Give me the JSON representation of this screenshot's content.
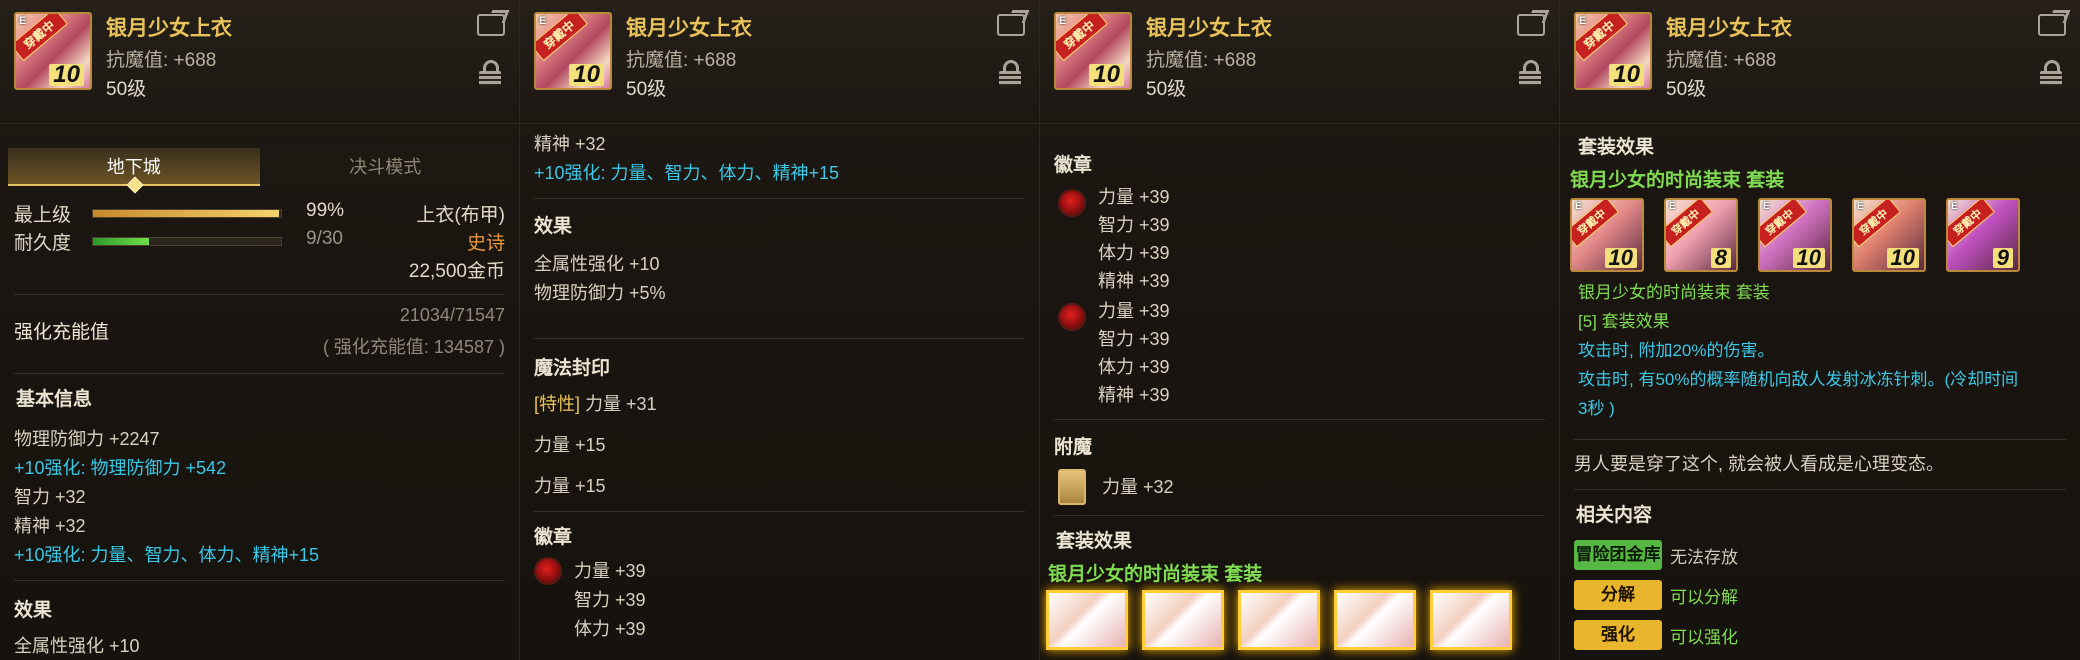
{
  "item": {
    "name": "银月少女上衣",
    "magic_resist": "抗魔值: +688",
    "level": "50级",
    "icon_stamp": "穿戴中",
    "icon_grade": "E",
    "icon_level": "10"
  },
  "panel1": {
    "tab_dungeon": "地下城",
    "tab_pvp": "决斗模式",
    "top_grade_label": "最上级",
    "top_grade_value": "99%",
    "top_grade_fill": 0.99,
    "durability_label": "耐久度",
    "durability_value": "9/30",
    "durability_fill": 0.3,
    "item_type": "上衣(布甲)",
    "rarity": "史诗",
    "price": "22,500金币",
    "enhance_charge_label": "强化充能值",
    "enhance_charge_value": "21034/71547",
    "enhance_charge_sub": "( 强化充能值: 134587 )",
    "basic_info_title": "基本信息",
    "basic_lines": [
      {
        "text": "物理防御力 +2247",
        "style": "normal"
      },
      {
        "text": "+10强化: 物理防御力 +542",
        "style": "blue"
      },
      {
        "text": "智力 +32",
        "style": "normal"
      },
      {
        "text": "精神 +32",
        "style": "normal"
      },
      {
        "text": "+10强化: 力量、智力、体力、精神+15",
        "style": "blue"
      }
    ],
    "effect_title": "效果",
    "effect_partial": "全属性强化 +10"
  },
  "panel2": {
    "line_spirit": "精神 +32",
    "line_enh": "+10强化: 力量、智力、体力、精神+15",
    "effect_title": "效果",
    "effect_lines": [
      "全属性强化 +10",
      "物理防御力 +5%"
    ],
    "seal_title": "魔法封印",
    "seal_trait_prefix": "[特性]",
    "seal_trait_text": " 力量 +31",
    "seal_lines": [
      "力量 +15",
      "力量 +15"
    ],
    "emblem_title": "徽章",
    "emblem_lines": [
      "力量 +39",
      "智力 +39",
      "体力 +39"
    ]
  },
  "panel3": {
    "emblem_title": "徽章",
    "emblem_group1": [
      "力量 +39",
      "智力 +39",
      "体力 +39",
      "精神 +39"
    ],
    "emblem_group2": [
      "力量 +39",
      "智力 +39",
      "体力 +39",
      "精神 +39"
    ],
    "enchant_title": "附魔",
    "enchant_value": "力量 +32",
    "set_title": "套装效果",
    "set_name": "银月少女的时尚装束 套装"
  },
  "panel4": {
    "set_title": "套装效果",
    "set_name": "银月少女的时尚装束 套装",
    "set_icons": [
      {
        "stamp": "穿戴中",
        "grade": "E",
        "level": "10",
        "color": "#e48a8a"
      },
      {
        "stamp": "穿戴中",
        "grade": "E",
        "level": "8",
        "color": "#f0a0b0"
      },
      {
        "stamp": "穿戴中",
        "grade": "E",
        "level": "10",
        "color": "#d070c0"
      },
      {
        "stamp": "穿戴中",
        "grade": "E",
        "level": "10",
        "color": "#e08070"
      },
      {
        "stamp": "穿戴中",
        "grade": "E",
        "level": "9",
        "color": "#c050c0"
      }
    ],
    "set_name2": "银月少女的时尚装束 套装",
    "set_bonus_title": "[5] 套装效果",
    "set_bonus_lines": [
      "攻击时, 附加20%的伤害。",
      "攻击时, 有50%的概率随机向敌人发射冰冻针刺。(冷却时间",
      "3秒 )"
    ],
    "flavor": "男人要是穿了这个, 就会被人看成是心理变态。",
    "related_title": "相关内容",
    "related": [
      {
        "tag": "冒险团金库",
        "text": "无法存放",
        "tag_style": "green-bg",
        "text_style": "normal"
      },
      {
        "tag": "分解",
        "text": "可以分解",
        "tag_style": "gold-bg",
        "text_style": "green"
      },
      {
        "tag": "强化",
        "text": "可以强化",
        "tag_style": "gold-bg",
        "text_style": "green"
      }
    ]
  },
  "colors": {
    "title_gold": "#e8c25a",
    "enhance_blue": "#3bc7e6",
    "set_green": "#7fdc52",
    "rarity_orange": "#e8963a"
  }
}
